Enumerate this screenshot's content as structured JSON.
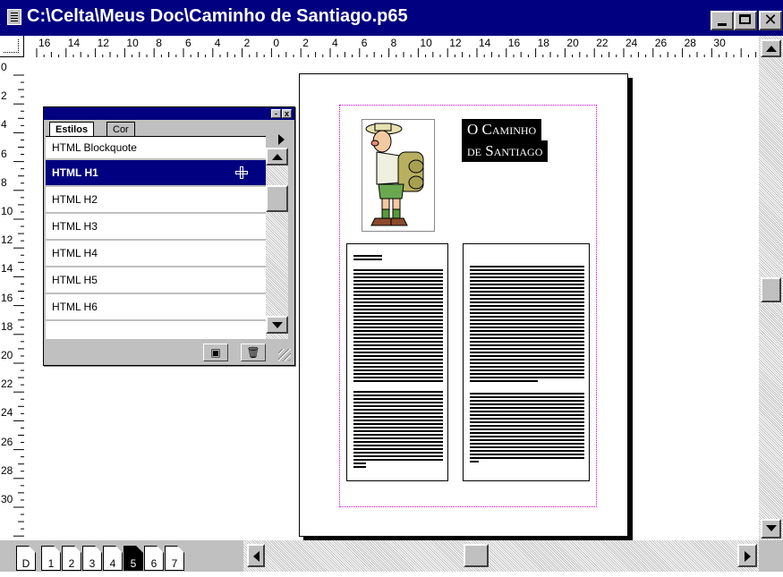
{
  "window": {
    "title": "C:\\Celta\\Meus Doc\\Caminho de Santiago.p65",
    "close_glyph": "✕"
  },
  "ruler": {
    "horizontal_labels": [
      "16",
      "14",
      "12",
      "10",
      "8",
      "6",
      "4",
      "2",
      "0",
      "2",
      "4",
      "6",
      "8",
      "10",
      "12",
      "14",
      "16",
      "18",
      "20",
      "22",
      "24",
      "26",
      "28",
      "30"
    ],
    "vertical_labels": [
      "0",
      "2",
      "4",
      "6",
      "8",
      "10",
      "12",
      "14",
      "16",
      "18",
      "20",
      "22",
      "24",
      "26",
      "28",
      "30"
    ]
  },
  "palette": {
    "tabs": [
      "Estilos",
      "Cor"
    ],
    "styles": [
      "HTML Blockquote",
      "HTML H1",
      "HTML H2",
      "HTML H3",
      "HTML H4",
      "HTML H5",
      "HTML H6"
    ],
    "selected_style": "HTML H1",
    "new_style_glyph": "▣",
    "delete_glyph": "🗑"
  },
  "document": {
    "title_line1": "O Caminho",
    "title_line2": "de Santiago"
  },
  "pages": {
    "master_label": "D",
    "numbers": [
      "1",
      "2",
      "3",
      "4",
      "5",
      "6",
      "7"
    ],
    "current": "5"
  },
  "colors": {
    "titlebar": "#000080",
    "selection": "#000080",
    "margin_guide": "#d000d0"
  },
  "icons": [
    "app-icon",
    "minimize-icon",
    "maximize-icon",
    "close-icon",
    "scroll-up-icon",
    "scroll-down-icon",
    "scroll-left-icon",
    "scroll-right-icon",
    "plus-cursor-icon",
    "new-style-icon",
    "trash-icon",
    "palette-menu-icon",
    "tab-arrow-icon"
  ]
}
